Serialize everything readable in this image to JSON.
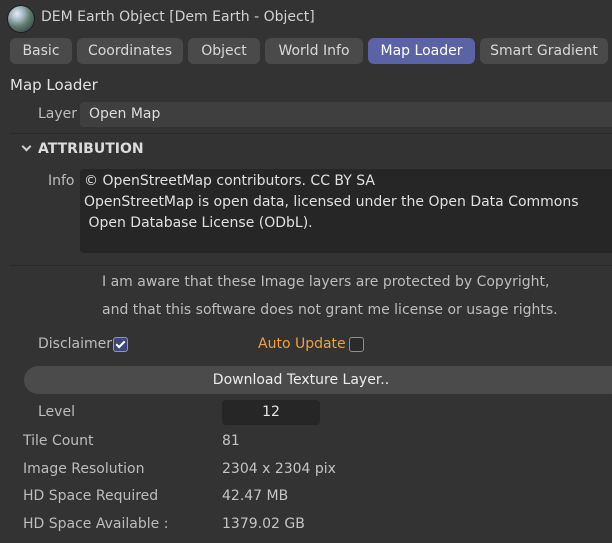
{
  "window": {
    "title": "DEM Earth Object [Dem Earth - Object]"
  },
  "tabs": [
    {
      "label": "Basic",
      "active": false
    },
    {
      "label": "Coordinates",
      "active": false
    },
    {
      "label": "Object",
      "active": false
    },
    {
      "label": "World Info",
      "active": false
    },
    {
      "label": "Map Loader",
      "active": true
    },
    {
      "label": "Smart Gradient",
      "active": false
    }
  ],
  "section": {
    "title": "Map Loader"
  },
  "layer": {
    "label": "Layer",
    "value": "Open Map"
  },
  "attribution": {
    "title": "ATTRIBUTION",
    "info_label": "Info",
    "info_lines": [
      "© OpenStreetMap contributors. CC BY SA",
      "OpenStreetMap is open data, licensed under the Open Data Commons",
      " Open Database License (ODbL)."
    ]
  },
  "notice": {
    "line1": "I am aware that these Image layers are protected by Copyright,",
    "line2": "and that this software does not grant me license or usage rights."
  },
  "disclaimer": {
    "label": "Disclaimer",
    "checked": true
  },
  "auto_update": {
    "label": "Auto Update",
    "checked": false,
    "label_color": "#f0a040"
  },
  "download_button": {
    "label": "Download Texture Layer.."
  },
  "level": {
    "label": "Level",
    "value": "12"
  },
  "stats": [
    {
      "label": "Tile Count",
      "value": "81"
    },
    {
      "label": "Image Resolution",
      "value": "2304 x 2304 pix"
    },
    {
      "label": "HD Space Required",
      "value": "42.47 MB"
    },
    {
      "label": "HD Space Available :",
      "value": "1379.02 GB"
    }
  ],
  "colors": {
    "background": "#333333",
    "active_tab": "#5b63a6",
    "tab": "#4a4a4a",
    "accent_orange": "#f0a040"
  }
}
